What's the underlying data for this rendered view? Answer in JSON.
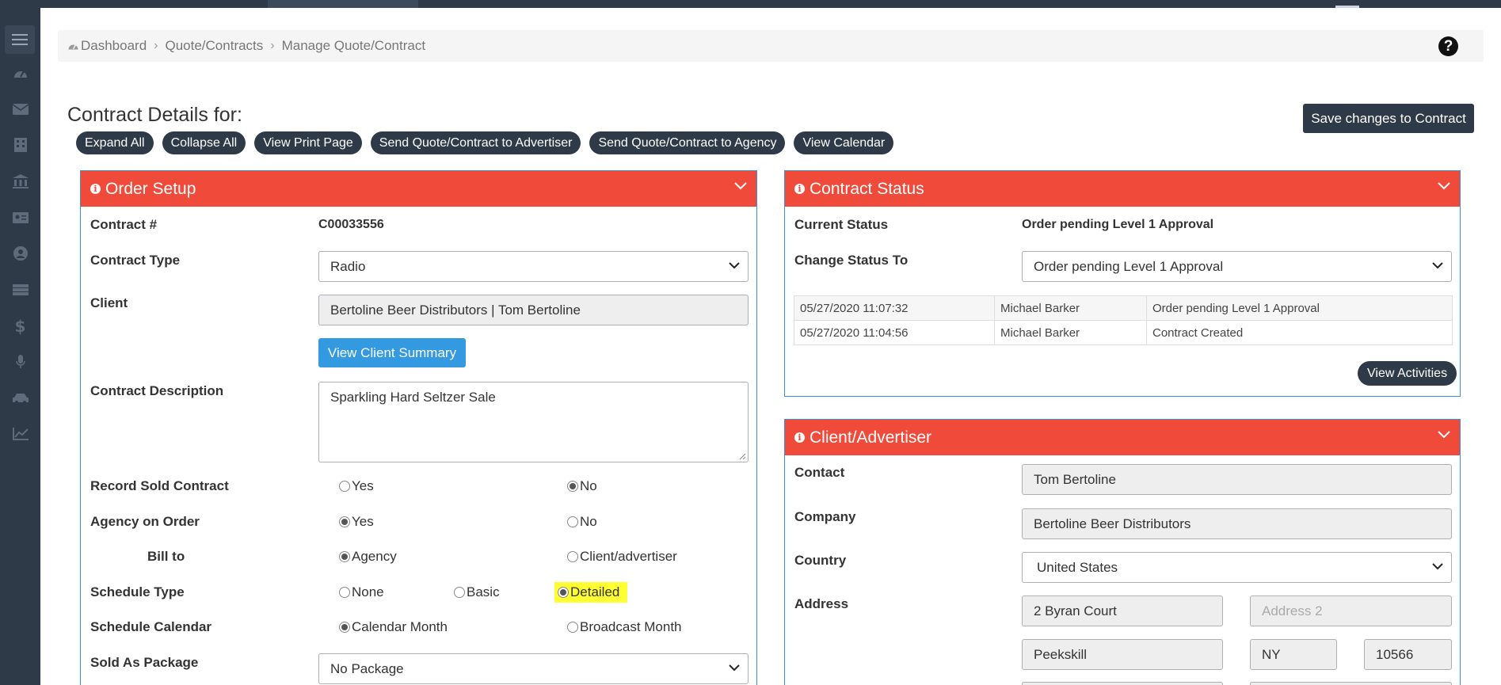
{
  "breadcrumb": {
    "items": [
      "Dashboard",
      "Quote/Contracts",
      "Manage Quote/Contract"
    ]
  },
  "page": {
    "title": "Contract Details for:",
    "save_label": "Save changes to Contract"
  },
  "actions": [
    "Expand All",
    "Collapse All",
    "View Print Page",
    "Send Quote/Contract to Advertiser",
    "Send Quote/Contract to Agency",
    "View Calendar"
  ],
  "order_setup": {
    "title": "Order Setup",
    "contract_num_label": "Contract #",
    "contract_num": "C00033556",
    "contract_type_label": "Contract Type",
    "contract_type": "Radio",
    "client_label": "Client",
    "client": "Bertoline Beer Distributors | Tom Bertoline",
    "view_client_summary": "View Client Summary",
    "description_label": "Contract Description",
    "description": "Sparkling Hard Seltzer Sale",
    "record_sold_label": "Record Sold Contract",
    "record_sold": {
      "yes": "Yes",
      "no": "No",
      "selected": "No"
    },
    "agency_label": "Agency on Order",
    "agency": {
      "yes": "Yes",
      "no": "No",
      "selected": "Yes"
    },
    "bill_to_label": "Bill to",
    "bill_to": {
      "a": "Agency",
      "b": "Client/advertiser",
      "selected": "Agency"
    },
    "schedule_type_label": "Schedule Type",
    "schedule_type": {
      "none": "None",
      "basic": "Basic",
      "detailed": "Detailed",
      "selected": "Detailed"
    },
    "schedule_calendar_label": "Schedule Calendar",
    "schedule_calendar": {
      "a": "Calendar Month",
      "b": "Broadcast Month",
      "selected": "Calendar Month"
    },
    "sold_as_package_label": "Sold As Package",
    "sold_as_package": "No Package"
  },
  "contract_status": {
    "title": "Contract Status",
    "current_label": "Current Status",
    "current": "Order pending Level 1 Approval",
    "change_label": "Change Status To",
    "change_value": "Order pending Level 1 Approval",
    "history": [
      {
        "date": "05/27/2020 11:07:32",
        "user": "Michael Barker",
        "status": "Order pending Level 1 Approval"
      },
      {
        "date": "05/27/2020 11:04:56",
        "user": "Michael Barker",
        "status": "Contract Created"
      }
    ],
    "view_activities": "View Activities"
  },
  "client_advertiser": {
    "title": "Client/Advertiser",
    "contact_label": "Contact",
    "contact": "Tom Bertoline",
    "company_label": "Company",
    "company": "Bertoline Beer Distributors",
    "country_label": "Country",
    "country": "United States",
    "address_label": "Address",
    "address1": "2 Byran Court",
    "address2_placeholder": "Address 2",
    "city": "Peekskill",
    "state": "NY",
    "zip": "10566"
  },
  "colors": {
    "panel_header": "#f04a3a",
    "panel_border": "#3a8fd6",
    "dark": "#2e3a48",
    "primary_button": "#3399e0",
    "highlight": "#ffff33"
  }
}
